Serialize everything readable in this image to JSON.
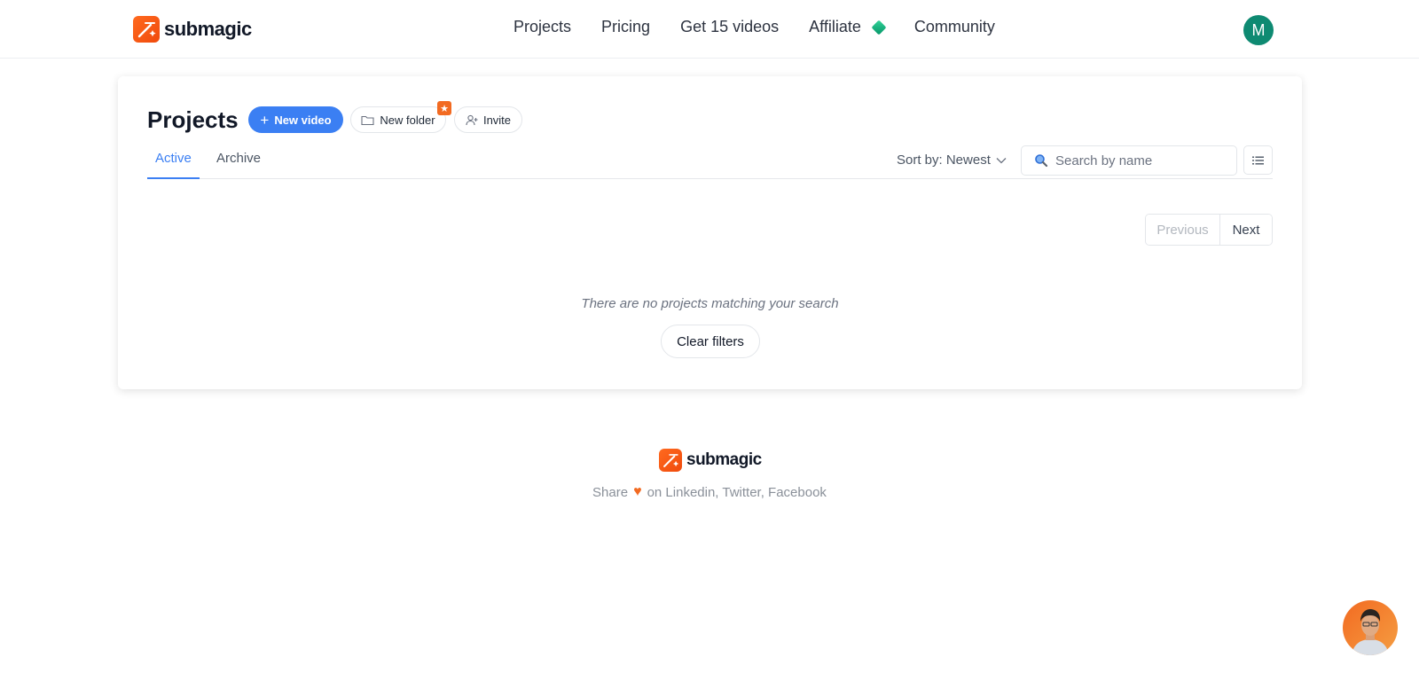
{
  "brand": {
    "name": "submagic",
    "color": "#f26a21",
    "icon": "wand-logo-icon"
  },
  "nav": {
    "items": [
      {
        "label": "Projects"
      },
      {
        "label": "Pricing"
      },
      {
        "label": "Get 15 videos"
      },
      {
        "label": "Affiliate",
        "icon": "diamond-icon"
      },
      {
        "label": "Community"
      }
    ],
    "avatar_initial": "M",
    "avatar_color": "#0e8a72"
  },
  "projects": {
    "title": "Projects",
    "new_video_label": "New video",
    "new_folder_label": "New folder",
    "invite_label": "Invite",
    "tabs": [
      {
        "label": "Active"
      },
      {
        "label": "Archive"
      }
    ],
    "sort_label": "Sort by: Newest",
    "search_placeholder": "Search by name",
    "pagination": {
      "previous": "Previous",
      "next": "Next"
    },
    "empty_message": "There are no projects matching your search",
    "clear_filters_label": "Clear filters",
    "accent_color": "#3b7ff3"
  },
  "footer": {
    "brand": "submagic",
    "share_prefix": "Share",
    "share_suffix": "on Linkedin, Twitter, Facebook"
  }
}
